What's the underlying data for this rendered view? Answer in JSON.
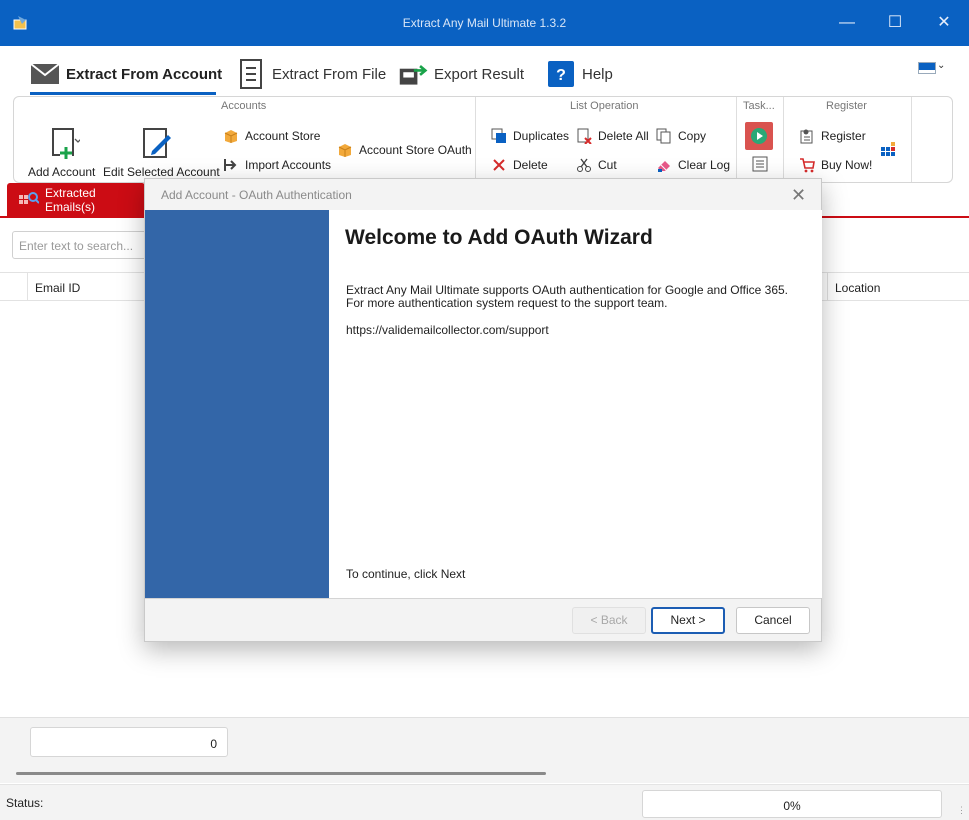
{
  "window": {
    "title": "Extract Any Mail Ultimate 1.3.2",
    "minimize": "—",
    "maximize": "☐",
    "close": "✕"
  },
  "main_tabs": [
    {
      "label": "Extract From Account",
      "icon": "envelope-icon",
      "active": true
    },
    {
      "label": "Extract From File",
      "icon": "document-icon",
      "active": false
    },
    {
      "label": "Export Result",
      "icon": "export-icon",
      "active": false
    },
    {
      "label": "Help",
      "icon": "help-icon",
      "active": false
    }
  ],
  "ribbon": {
    "accounts": {
      "title": "Accounts",
      "add_account": "Add Account",
      "edit_selected_account": "Edit Selected Account",
      "account_store": "Account Store",
      "import_accounts": "Import Accounts",
      "account_store_oauth": "Account Store OAuth"
    },
    "list_operation": {
      "title": "List Operation",
      "duplicates": "Duplicates",
      "delete_all": "Delete All",
      "copy": "Copy",
      "delete": "Delete",
      "cut": "Cut",
      "clear_log": "Clear Log"
    },
    "task": {
      "title": "Task..."
    },
    "register": {
      "title": "Register",
      "register": "Register",
      "buy_now": "Buy Now!"
    }
  },
  "doc_tab": {
    "label": "Extracted Emails(s)"
  },
  "search": {
    "placeholder": "Enter text to search..."
  },
  "grid": {
    "columns": [
      "Email ID",
      "Location"
    ]
  },
  "footer": {
    "count": "0",
    "status_label": "Status:",
    "progress": "0%"
  },
  "dialog": {
    "title": "Add Account - OAuth Authentication",
    "heading": "Welcome to Add OAuth Wizard",
    "body": "Extract Any Mail Ultimate supports OAuth authentication for Google and Office 365. For more authentication system request to the support team.",
    "link": "https://validemailcollector.com/support",
    "continue_hint": "To continue, click Next",
    "back_button": "< Back",
    "next_button": "Next >",
    "cancel_button": "Cancel",
    "close": "✕"
  },
  "colors": {
    "titlebar": "#0a61c2",
    "doc_tab": "#cc0c14",
    "dialog_side": "#3366a8"
  }
}
